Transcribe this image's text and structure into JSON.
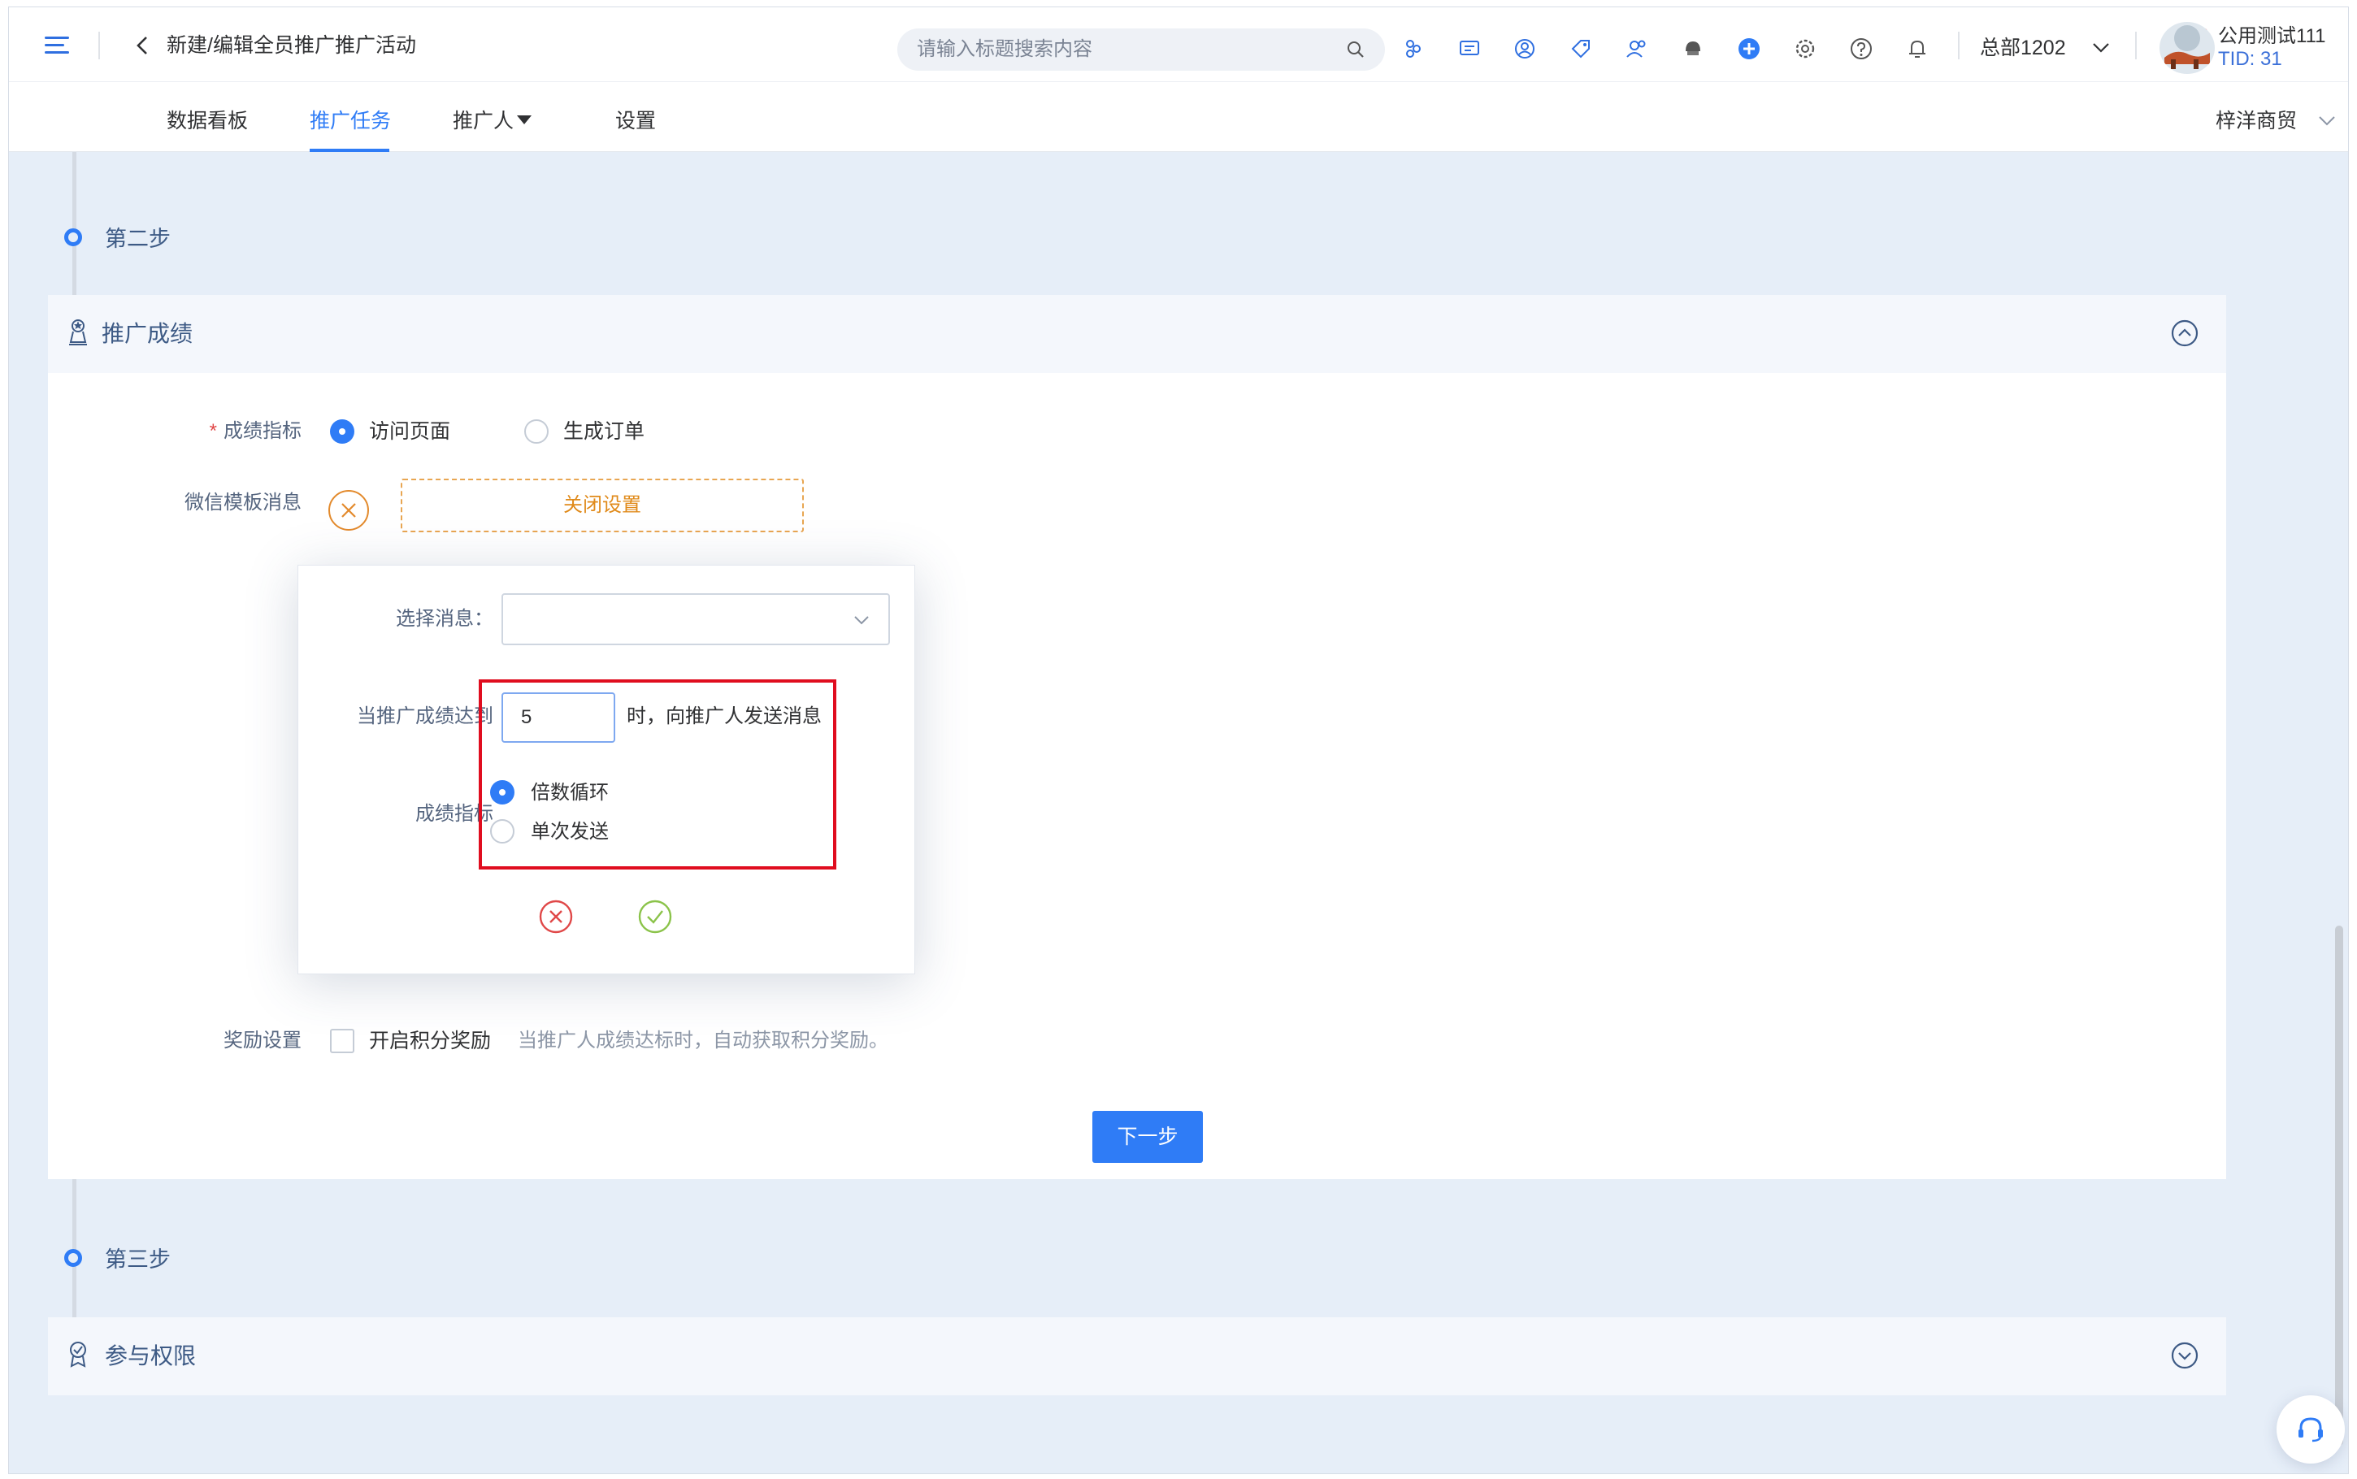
{
  "header": {
    "page_title": "新建/编辑全员推广推广活动",
    "search_placeholder": "请输入标题搜索内容",
    "store_name": "总部1202",
    "user_name": "公用测试111",
    "user_tid": "TID: 31"
  },
  "tabs": [
    {
      "label": "数据看板"
    },
    {
      "label": "推广任务"
    },
    {
      "label": "推广人"
    },
    {
      "label": "设置"
    }
  ],
  "merchant_name": "梓洋商贸",
  "steps": {
    "step2": "第二步",
    "step3": "第三步"
  },
  "sections": {
    "promo_score": "推广成绩",
    "permissions": "参与权限"
  },
  "form": {
    "metric_label": "成绩指标",
    "metric_options": [
      "访问页面",
      "生成订单"
    ],
    "metric_selected": "访问页面",
    "wechat_label": "微信模板消息",
    "close_setting": "关闭设置",
    "reward_label": "奖励设置",
    "reward_checkbox": "开启积分奖励",
    "reward_hint": "当推广人成绩达标时，自动获取积分奖励。",
    "next_button": "下一步"
  },
  "popover": {
    "select_label": "选择消息：",
    "select_value": "",
    "threshold_label": "当推广成绩达到",
    "threshold_value": "5",
    "threshold_suffix": "时，向推广人发送消息",
    "mode_label": "成绩指标",
    "mode_options": [
      "倍数循环",
      "单次发送"
    ],
    "mode_selected": "倍数循环"
  },
  "colors": {
    "accent": "#2f7cf6",
    "highlight": "#e00d1f",
    "warning": "#e38a2c",
    "success": "#8bc34a",
    "danger": "#e04848"
  }
}
